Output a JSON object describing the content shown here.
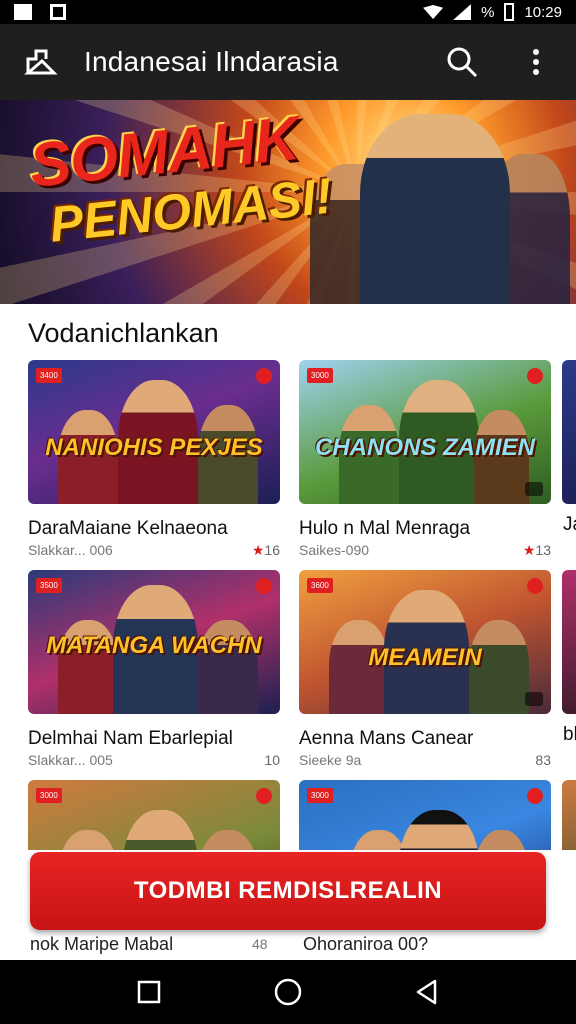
{
  "status_bar": {
    "battery_text": "%",
    "time": "10:29"
  },
  "app_bar": {
    "title": "Indanesai Ilndarasia"
  },
  "banner": {
    "line1": "SOMAHK",
    "line2": "PENOMASI!"
  },
  "section": {
    "title": "Vodanichlankan"
  },
  "cards": [
    {
      "thumb_title": "NANIOHIS PEXJES",
      "badge": "3400",
      "name": "DaraMaiane Kelnaeona",
      "meta": "Slakkar... 006",
      "rating": "16"
    },
    {
      "thumb_title": "CHANONS ZAMIEN",
      "badge": "3000",
      "name": "Hulo n Mal Menraga",
      "meta": "Saikes-090",
      "rating": "13"
    },
    {
      "thumb_title": "MATANGA WACHN",
      "badge": "3500",
      "name": "Delmhai Nam Ebarlepial",
      "meta": "Slakkar... 005",
      "rating": "10"
    },
    {
      "thumb_title": "MEAMEIN",
      "badge": "3600",
      "name": "Aenna Mans Canear",
      "meta": "Sieeke 9a",
      "rating": "83"
    },
    {
      "thumb_title": "",
      "badge": "3000",
      "name": "nok Maripe Mabal",
      "meta": "",
      "rating": "48"
    },
    {
      "thumb_title": "",
      "badge": "3000",
      "name": "Ohoraniroa 00?",
      "meta": "",
      "rating": ""
    }
  ],
  "peek_labels": [
    "Ja",
    "Ja",
    "bl",
    "bl"
  ],
  "cta": {
    "label": "TODMBI REMDISLREALIN"
  },
  "colors": {
    "accent": "#e02020",
    "app_bar": "#1f1f1f"
  }
}
